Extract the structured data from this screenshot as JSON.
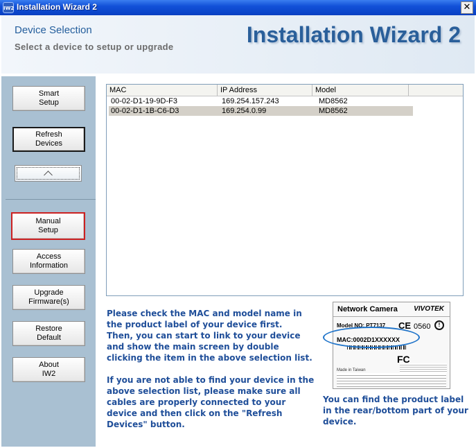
{
  "window": {
    "title": "Installation Wizard 2",
    "app_icon_text": "IW2",
    "close_glyph": "✕"
  },
  "header": {
    "section_title": "Device Selection",
    "subtitle": "Select a device to setup or upgrade",
    "brand_title": "Installation Wizard 2"
  },
  "sidebar": {
    "smart_setup": "Smart\nSetup",
    "refresh_devices": "Refresh\nDevices",
    "collapse_icon": "chevron-up-icon",
    "manual_setup": "Manual\nSetup",
    "access_information": "Access\nInformation",
    "upgrade_firmware": "Upgrade\nFirmware(s)",
    "restore_default": "Restore\nDefault",
    "about": "About\nIW2"
  },
  "device_list": {
    "columns": [
      "MAC",
      "IP Address",
      "Model"
    ],
    "rows": [
      {
        "mac": "00-02-D1-19-9D-F3",
        "ip": "169.254.157.243",
        "model": "MD8562",
        "selected": false
      },
      {
        "mac": "00-02-D1-1B-C6-D3",
        "ip": "169.254.0.99",
        "model": "MD8562",
        "selected": true
      }
    ]
  },
  "instructions": {
    "p1": "Please check the MAC and model name in the product label of your device first.",
    "p2": "Then, you can start to link to your device and show the main screen by double clicking the item in the above selection list.",
    "p3": "If you are not able to find your device in the above selection list, please make sure all cables are properly connected to your device and then click on the \"Refresh Devices\" button."
  },
  "product_label": {
    "name": "Network Camera",
    "brand": "VIVOTEK",
    "model_no": "Model NO: PT7137",
    "ce": "CE",
    "num": "0560",
    "mac": "MAC:0002D1XXXXXX",
    "fc": "FC",
    "made_in": "Made in Taiwan",
    "note": "You can find the product label in the rear/bottom part of your device."
  },
  "colors": {
    "accent_text": "#1f4e99",
    "sidebar_bg": "#a9c0d2",
    "active_border": "#cc2020",
    "highlight_oval": "#1e73c9"
  }
}
